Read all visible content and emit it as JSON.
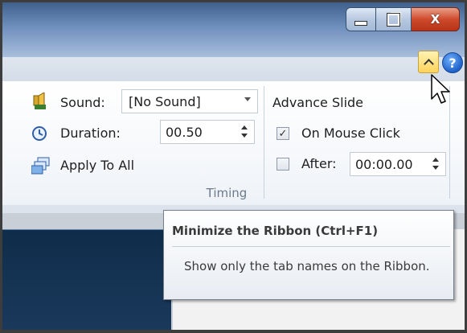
{
  "window_controls": {
    "minimize_icon": "minimize-icon",
    "maximize_icon": "maximize-icon",
    "close_label": "X"
  },
  "ribbon": {
    "help_label": "?",
    "timing_group": {
      "label": "Timing",
      "sound_label": "Sound:",
      "sound_value": "[No Sound]",
      "duration_label": "Duration:",
      "duration_value": "00.50",
      "apply_to_all_label": "Apply To All",
      "advance_slide_label": "Advance Slide",
      "on_mouse_click_label": "On Mouse Click",
      "on_mouse_click_checked": true,
      "after_label": "After:",
      "after_checked": false,
      "after_value": "00:00.00"
    }
  },
  "tooltip": {
    "title": "Minimize the Ribbon (Ctrl+F1)",
    "body": "Show only the tab names on the Ribbon."
  },
  "colors": {
    "highlight_button": "#ffd35a",
    "titlebar": "#6f8fbd",
    "close_button": "#cf4a2c"
  }
}
